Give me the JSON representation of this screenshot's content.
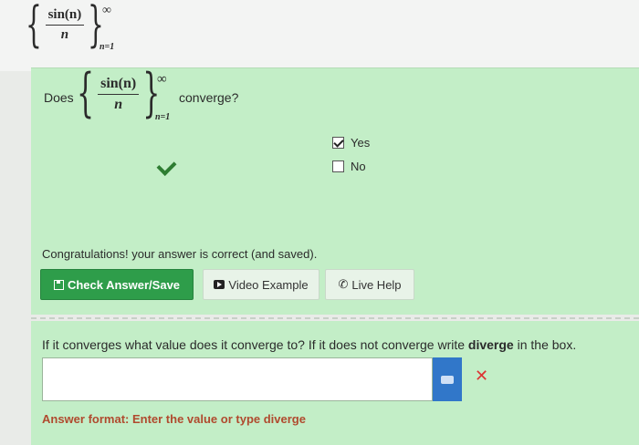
{
  "header_expression": {
    "numerator": "sin(n)",
    "denominator": "n",
    "upper": "∞",
    "lower": "n=1"
  },
  "question1": {
    "prefix": "Does",
    "expression": {
      "numerator": "sin(n)",
      "denominator": "n",
      "upper": "∞",
      "lower": "n=1"
    },
    "suffix": "converge?"
  },
  "options": [
    {
      "label": "Yes",
      "checked": true
    },
    {
      "label": "No",
      "checked": false
    }
  ],
  "feedback": "Congratulations! your answer is correct (and saved).",
  "buttons": {
    "check_answer": "Check Answer/Save",
    "video_example": "Video Example",
    "live_help": "Live Help"
  },
  "question2": {
    "text_before": "If it converges what value does it converge to? If it does not converge write ",
    "bold_word": "diverge",
    "text_after": " in the box."
  },
  "answer_input": {
    "value": ""
  },
  "answer_format": "Answer format: Enter the value or type diverge",
  "colors": {
    "panel_green": "#c3eec7",
    "button_green": "#2e9d4a",
    "keyboard_blue": "#3177c9",
    "error_red": "#dd3333",
    "format_text": "#b04a2e"
  }
}
